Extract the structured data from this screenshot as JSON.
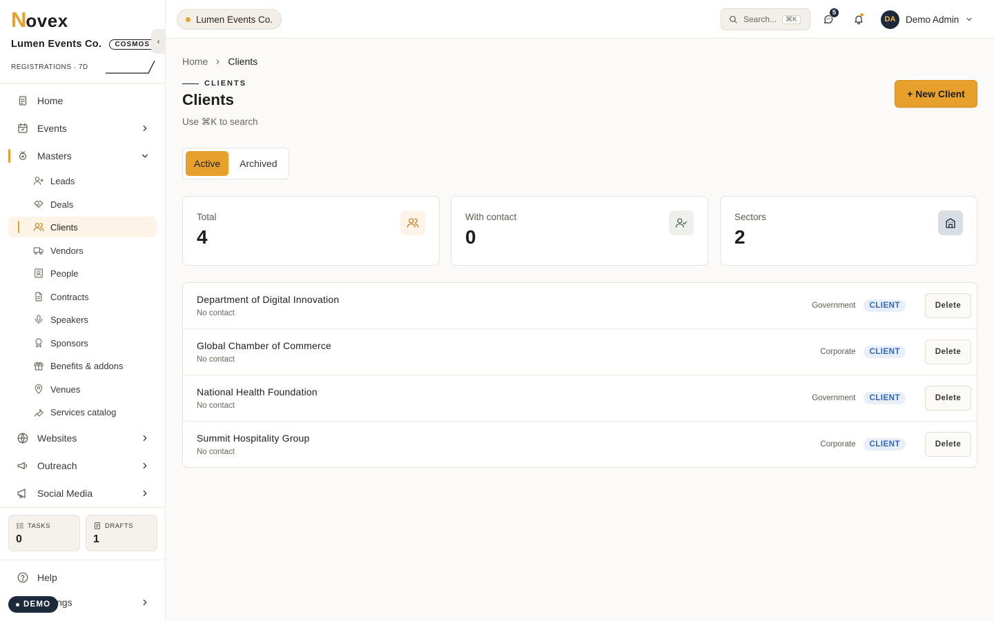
{
  "sidebar": {
    "logo_n": "N",
    "logo_rest": "ovex",
    "org_name": "Lumen Events Co.",
    "org_badge": "COSMOS",
    "collapse_glyph": "‹",
    "registrations_label": "REGISTRATIONS · 7D",
    "nav": {
      "home": "Home",
      "events": "Events",
      "masters": "Masters",
      "websites": "Websites",
      "outreach": "Outreach",
      "social_media": "Social Media"
    },
    "masters_items": [
      "Leads",
      "Deals",
      "Clients",
      "Vendors",
      "People",
      "Contracts",
      "Speakers",
      "Sponsors",
      "Benefits & addons",
      "Venues",
      "Services catalog"
    ],
    "tasks": {
      "label": "TASKS",
      "value": "0"
    },
    "drafts": {
      "label": "DRAFTS",
      "value": "1"
    },
    "help": "Help",
    "settings": "Settings",
    "demo_badge": "DEMO"
  },
  "topbar": {
    "org_pill": "Lumen Events Co.",
    "search_placeholder": "Search...",
    "search_shortcut": "⌘K",
    "messages_count": "5",
    "user_initials": "DA",
    "user_name": "Demo Admin"
  },
  "main": {
    "breadcrumb": {
      "home": "Home",
      "current": "Clients"
    },
    "eyebrow": "CLIENTS",
    "title": "Clients",
    "subtitle": "Use ⌘K to search",
    "new_button": "+ New Client",
    "tabs": [
      "Active",
      "Archived"
    ],
    "kpis": [
      {
        "label": "Total",
        "value": "4"
      },
      {
        "label": "With contact",
        "value": "0"
      },
      {
        "label": "Sectors",
        "value": "2"
      }
    ],
    "clients": [
      {
        "name": "Department of Digital Innovation",
        "contact": "No contact",
        "sector": "Government",
        "tag": "CLIENT",
        "action": "Delete"
      },
      {
        "name": "Global Chamber of Commerce",
        "contact": "No contact",
        "sector": "Corporate",
        "tag": "CLIENT",
        "action": "Delete"
      },
      {
        "name": "National Health Foundation",
        "contact": "No contact",
        "sector": "Government",
        "tag": "CLIENT",
        "action": "Delete"
      },
      {
        "name": "Summit Hospitality Group",
        "contact": "No contact",
        "sector": "Corporate",
        "tag": "CLIENT",
        "action": "Delete"
      }
    ]
  },
  "colors": {
    "accent": "#e7a02c",
    "navy": "#1c2a3b",
    "tag_blue": "#3167b8",
    "tag_bg": "#e8eefa"
  },
  "icons": {
    "nav": [
      "home-icon",
      "calendar-icon",
      "masters-icon",
      "globe-icon",
      "megaphone-icon",
      "megaphone-icon"
    ],
    "masters": [
      "user-plus-icon",
      "handshake-icon",
      "users-icon",
      "truck-icon",
      "id-badge-icon",
      "file-text-icon",
      "microphone-icon",
      "award-icon",
      "gift-icon",
      "map-pin-icon",
      "wrench-icon"
    ],
    "kpis": [
      "users-icon",
      "user-check-icon",
      "building-icon"
    ]
  }
}
